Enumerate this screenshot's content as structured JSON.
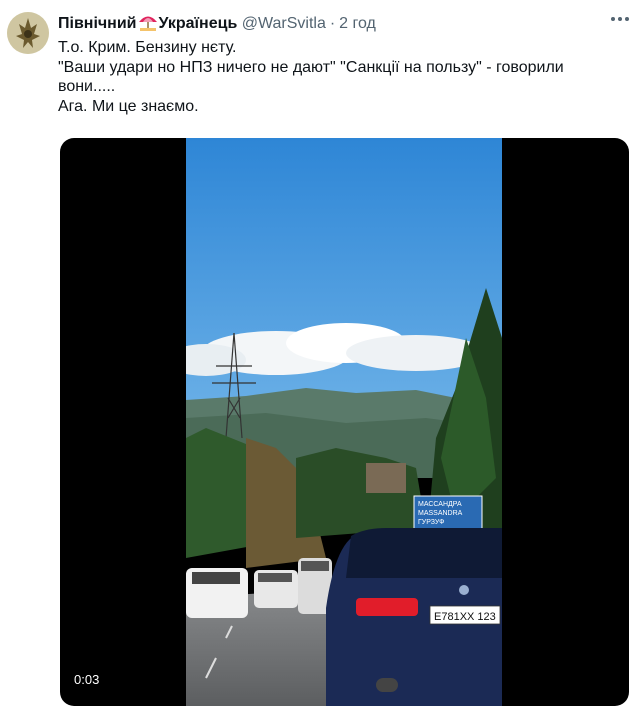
{
  "tweet": {
    "display_name": "Північний",
    "display_name_suffix": "Українець",
    "handle": "@WarSvitla",
    "separator": "·",
    "time": "2 год",
    "more_icon": "more-dots-icon",
    "lines": [
      "Т.о. Крим. Бензину нєту.",
      "\"Ваши удари но НПЗ ничего не дают\" \"Санкції на пользу\" - говорили вони.....",
      "Ага. Ми це знаємо."
    ]
  },
  "media": {
    "timestamp": "0:03",
    "road_sign": [
      "МАССАНДРА",
      "MASSANDRA",
      "ГУРЗУФ"
    ],
    "license_plate": "Е781ХХ 123"
  },
  "colors": {
    "text": "#0f1419",
    "secondary": "#536471",
    "video_background": "#000000",
    "sky": "#3a8fd8"
  }
}
